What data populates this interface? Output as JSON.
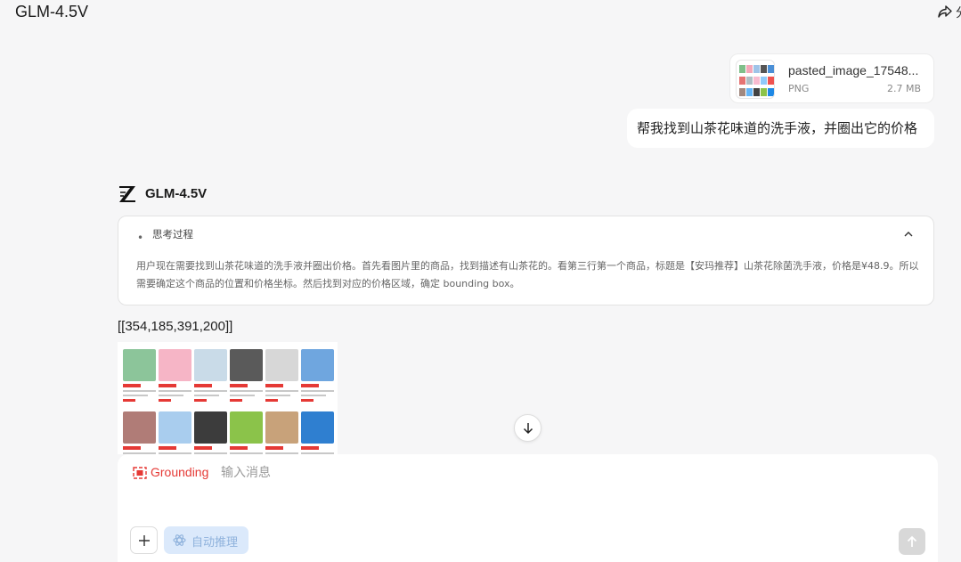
{
  "header": {
    "title": "GLM-4.5V",
    "cut_glyph": "分"
  },
  "attachment": {
    "name": "pasted_image_17548...",
    "type": "PNG",
    "size": "2.7 MB"
  },
  "user_message": {
    "text": "帮我找到山茶花味道的洗手液，并圈出它的价格"
  },
  "assistant": {
    "model_name": "GLM-4.5V",
    "thinking": {
      "title": "思考过程",
      "text": "用户现在需要找到山茶花味道的洗手液并圈出价格。首先看图片里的商品，找到描述有山茶花的。看第三行第一个商品，标题是【安玛推荐】山茶花除菌洗手液，价格是¥48.9。所以需要确定这个商品的位置和价格坐标。然后找到对应的价格区域，确定 bounding box。"
    },
    "answer": "[[354,185,391,200]]"
  },
  "composer": {
    "grounding_label": "Grounding",
    "placeholder": "输入消息",
    "auto_reason_label": "自动推理"
  },
  "colors": {
    "accent": "#e53935",
    "auto_reason_bg": "#dbe9fb",
    "page_bg": "#f6f6f7"
  }
}
